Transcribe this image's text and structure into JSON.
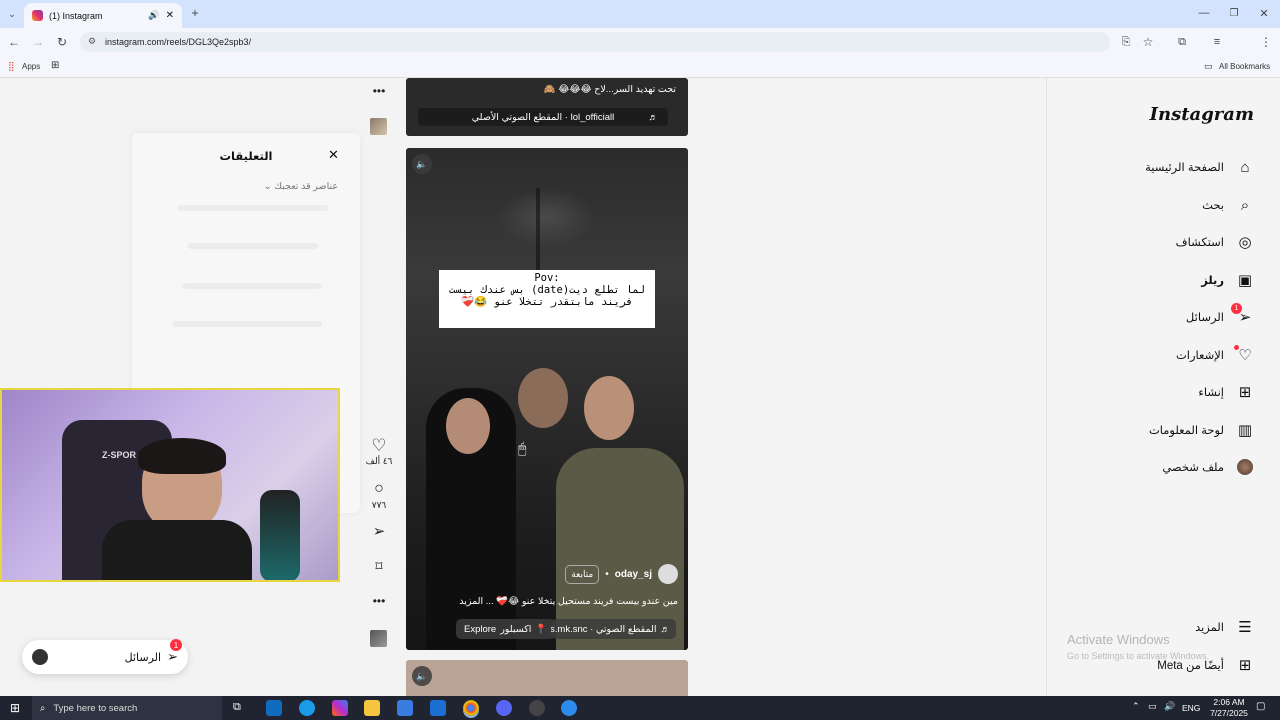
{
  "browser": {
    "tab_title": "(1) Instagram",
    "url": "instagram.com/reels/DGL3Qe2spb3/",
    "bookmarks_apps": "Apps",
    "bookmarks_all": "All Bookmarks"
  },
  "sidebar": {
    "logo": "Instagram",
    "items": [
      {
        "label": "الصفحة الرئيسية",
        "icon": "home-icon"
      },
      {
        "label": "بحث",
        "icon": "search-icon"
      },
      {
        "label": "استكشاف",
        "icon": "compass-icon"
      },
      {
        "label": "ريلز",
        "icon": "reels-icon"
      },
      {
        "label": "الرسائل",
        "icon": "send-icon",
        "badge": "1"
      },
      {
        "label": "الإشعارات",
        "icon": "heart-icon"
      },
      {
        "label": "إنشاء",
        "icon": "plus-icon"
      },
      {
        "label": "لوحة المعلومات",
        "icon": "dashboard-icon"
      },
      {
        "label": "ملف شخصي",
        "icon": "avatar-icon"
      }
    ],
    "more": "المزيد",
    "also_from_meta": "أيضًا من Meta"
  },
  "previous_reel": {
    "caption": "تحت تهديد السر...لاح 😂😂😂 🙈",
    "audio": "lol_officiall · المقطع الصوتي الأصلي"
  },
  "reel": {
    "overlay_title": "Pov:",
    "overlay_text": "لما تطلع ديت(date) بس عندك بيست فريند مابتقدر تتخلا عنو 😂❤️‍🩹",
    "username": "oday_sj",
    "follow": "متابعة",
    "caption": "مين عندو بيست فريند مستحيل يتخلا عنو 😂❤️‍🩹 ... المزيد",
    "audio_label": "its.mk.snc · المقطع الصوتي",
    "explore_label": "Explore",
    "location_label": "اكسبلور"
  },
  "actions": {
    "likes": "٤٦ ألف",
    "comments": "٧٧٦"
  },
  "comments_panel": {
    "title": "التعليقات",
    "filter": "عناصر قد تعجبك"
  },
  "messages_pill": {
    "label": "الرسائل",
    "badge": "1"
  },
  "watermark": {
    "line1": "Activate Windows",
    "line2": "Go to Settings to activate Windows."
  },
  "webcam": {
    "chair_text": "Z-SPOR"
  },
  "taskbar": {
    "search_placeholder": "Type here to search",
    "lang": "ENG",
    "time": "2:06 AM",
    "date": "7/27/2025"
  },
  "colors": {
    "accent_red": "#ff3040",
    "taskbar": "#1f2430",
    "webcam_border": "#e8d542"
  }
}
